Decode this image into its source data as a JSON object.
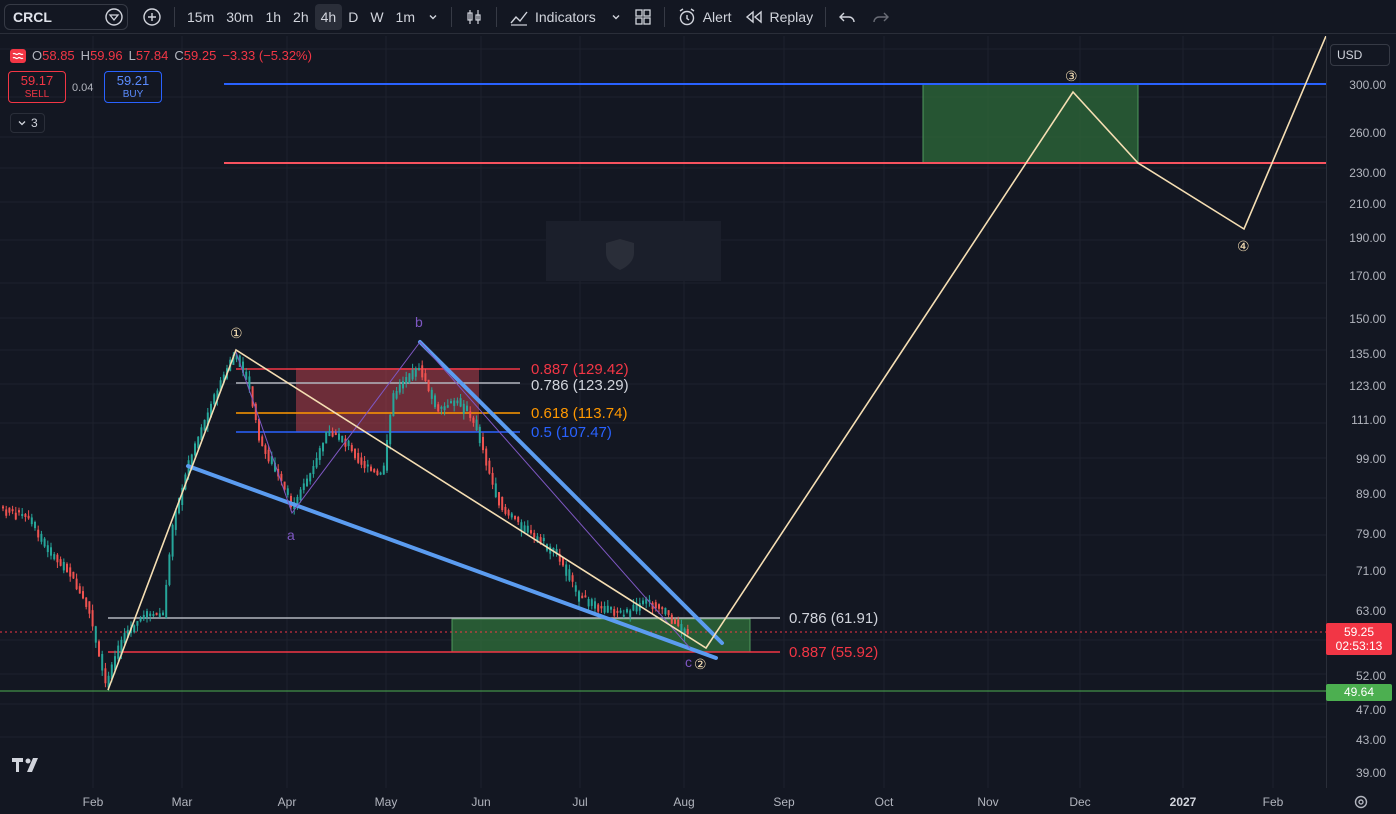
{
  "toolbar": {
    "symbol": "CRCL",
    "intervals": [
      "15m",
      "30m",
      "1h",
      "2h",
      "4h",
      "D",
      "W",
      "1m"
    ],
    "active_interval": "4h",
    "indicators_label": "Indicators",
    "alert_label": "Alert",
    "replay_label": "Replay"
  },
  "legend": {
    "o_label": "O",
    "o": "58.85",
    "h_label": "H",
    "h": "59.96",
    "l_label": "L",
    "l": "57.84",
    "c_label": "C",
    "c": "59.25",
    "change": "−3.33 (−5.32%)"
  },
  "trade": {
    "sell_price": "59.17",
    "sell_label": "SELL",
    "spread": "0.04",
    "buy_price": "59.21",
    "buy_label": "BUY"
  },
  "collapse_count": "3",
  "currency": "USD",
  "price_axis": [
    "300.00",
    "260.00",
    "230.00",
    "210.00",
    "190.00",
    "170.00",
    "150.00",
    "135.00",
    "123.00",
    "111.00",
    "99.00",
    "89.00",
    "79.00",
    "71.00",
    "63.00",
    "52.00",
    "47.00",
    "43.00",
    "39.00"
  ],
  "time_axis": [
    "Feb",
    "Mar",
    "Apr",
    "May",
    "Jun",
    "Jul",
    "Aug",
    "Sep",
    "Oct",
    "Nov",
    "Dec",
    "2027",
    "Feb"
  ],
  "current_price": {
    "price": "59.25",
    "countdown": "02:53:13",
    "color": "#f23645"
  },
  "support_price": {
    "price": "49.64",
    "color": "#4caf50"
  },
  "fib_levels": {
    "l887": "0.887 (129.42)",
    "l786": "0.786 (123.29)",
    "l618": "0.618 (113.74)",
    "l5": "0.5 (107.47)",
    "b786": "0.786 (61.91)",
    "b887": "0.887 (55.92)"
  },
  "wave_labels": {
    "w1": "①",
    "w2": "②",
    "w3": "③",
    "w4": "④",
    "a": "a",
    "b": "b",
    "c": "c"
  },
  "colors": {
    "bg": "#131722",
    "up": "#26a69a",
    "down": "#ef5350",
    "blue_line": "#2962ff",
    "red_line": "#f7525f",
    "wave_line": "#f5deb3",
    "channel": "#5b9cf0"
  }
}
